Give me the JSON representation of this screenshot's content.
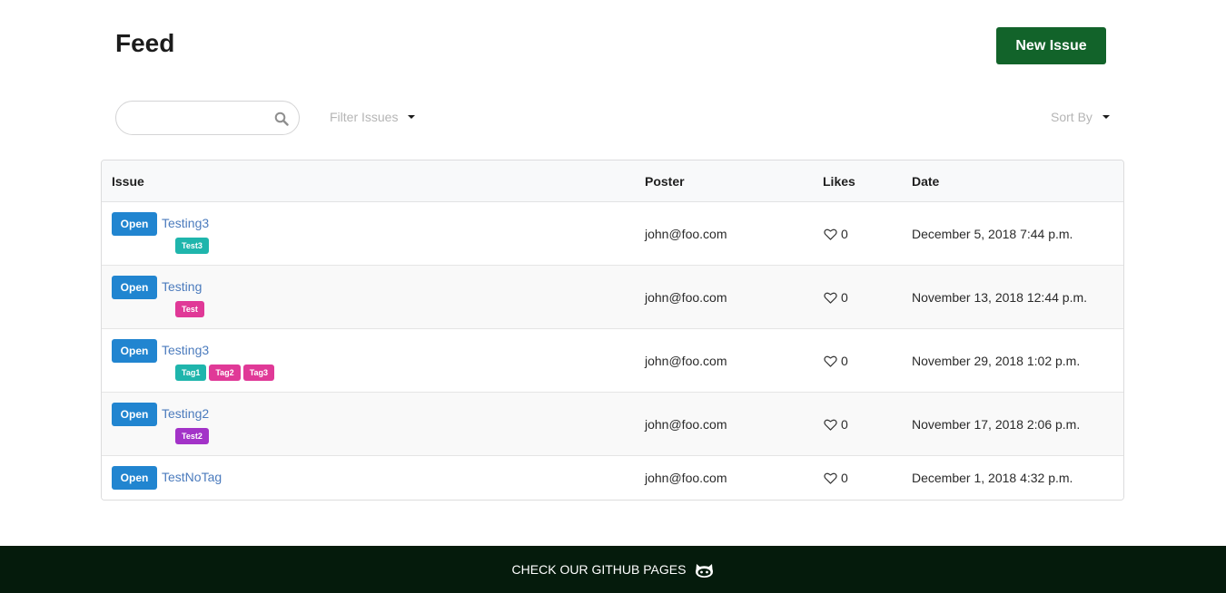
{
  "page": {
    "title": "Feed"
  },
  "header": {
    "new_issue_label": "New Issue"
  },
  "toolbar": {
    "search": {
      "value": "",
      "placeholder": ""
    },
    "filter_label": "Filter Issues",
    "sort_label": "Sort By"
  },
  "table": {
    "columns": [
      "Issue",
      "Poster",
      "Likes",
      "Date"
    ],
    "rows": [
      {
        "status": "Open",
        "title": "Testing3",
        "tags": [
          {
            "label": "Test3",
            "color": "#1fb5ac"
          }
        ],
        "poster": "john@foo.com",
        "likes": "0",
        "date": "December 5, 2018 7:44 p.m."
      },
      {
        "status": "Open",
        "title": "Testing",
        "tags": [
          {
            "label": "Test",
            "color": "#e03997"
          }
        ],
        "poster": "john@foo.com",
        "likes": "0",
        "date": "November 13, 2018 12:44 p.m."
      },
      {
        "status": "Open",
        "title": "Testing3",
        "tags": [
          {
            "label": "Tag1",
            "color": "#1fb5ac"
          },
          {
            "label": "Tag2",
            "color": "#e03997"
          },
          {
            "label": "Tag3",
            "color": "#e03997"
          }
        ],
        "poster": "john@foo.com",
        "likes": "0",
        "date": "November 29, 2018 1:02 p.m."
      },
      {
        "status": "Open",
        "title": "Testing2",
        "tags": [
          {
            "label": "Test2",
            "color": "#a333c8"
          }
        ],
        "poster": "john@foo.com",
        "likes": "0",
        "date": "November 17, 2018 2:06 p.m."
      },
      {
        "status": "Open",
        "title": "TestNoTag",
        "tags": [],
        "poster": "john@foo.com",
        "likes": "0",
        "date": "December 1, 2018 4:32 p.m."
      }
    ]
  },
  "footer": {
    "link_label": "CHECK OUR GITHUB PAGES",
    "icon": "github-octocat-icon"
  },
  "colors": {
    "brand_green": "#12632a",
    "status_blue": "#2185d0",
    "link_blue": "#4b7bbd",
    "footer_bg": "#051b0c"
  }
}
